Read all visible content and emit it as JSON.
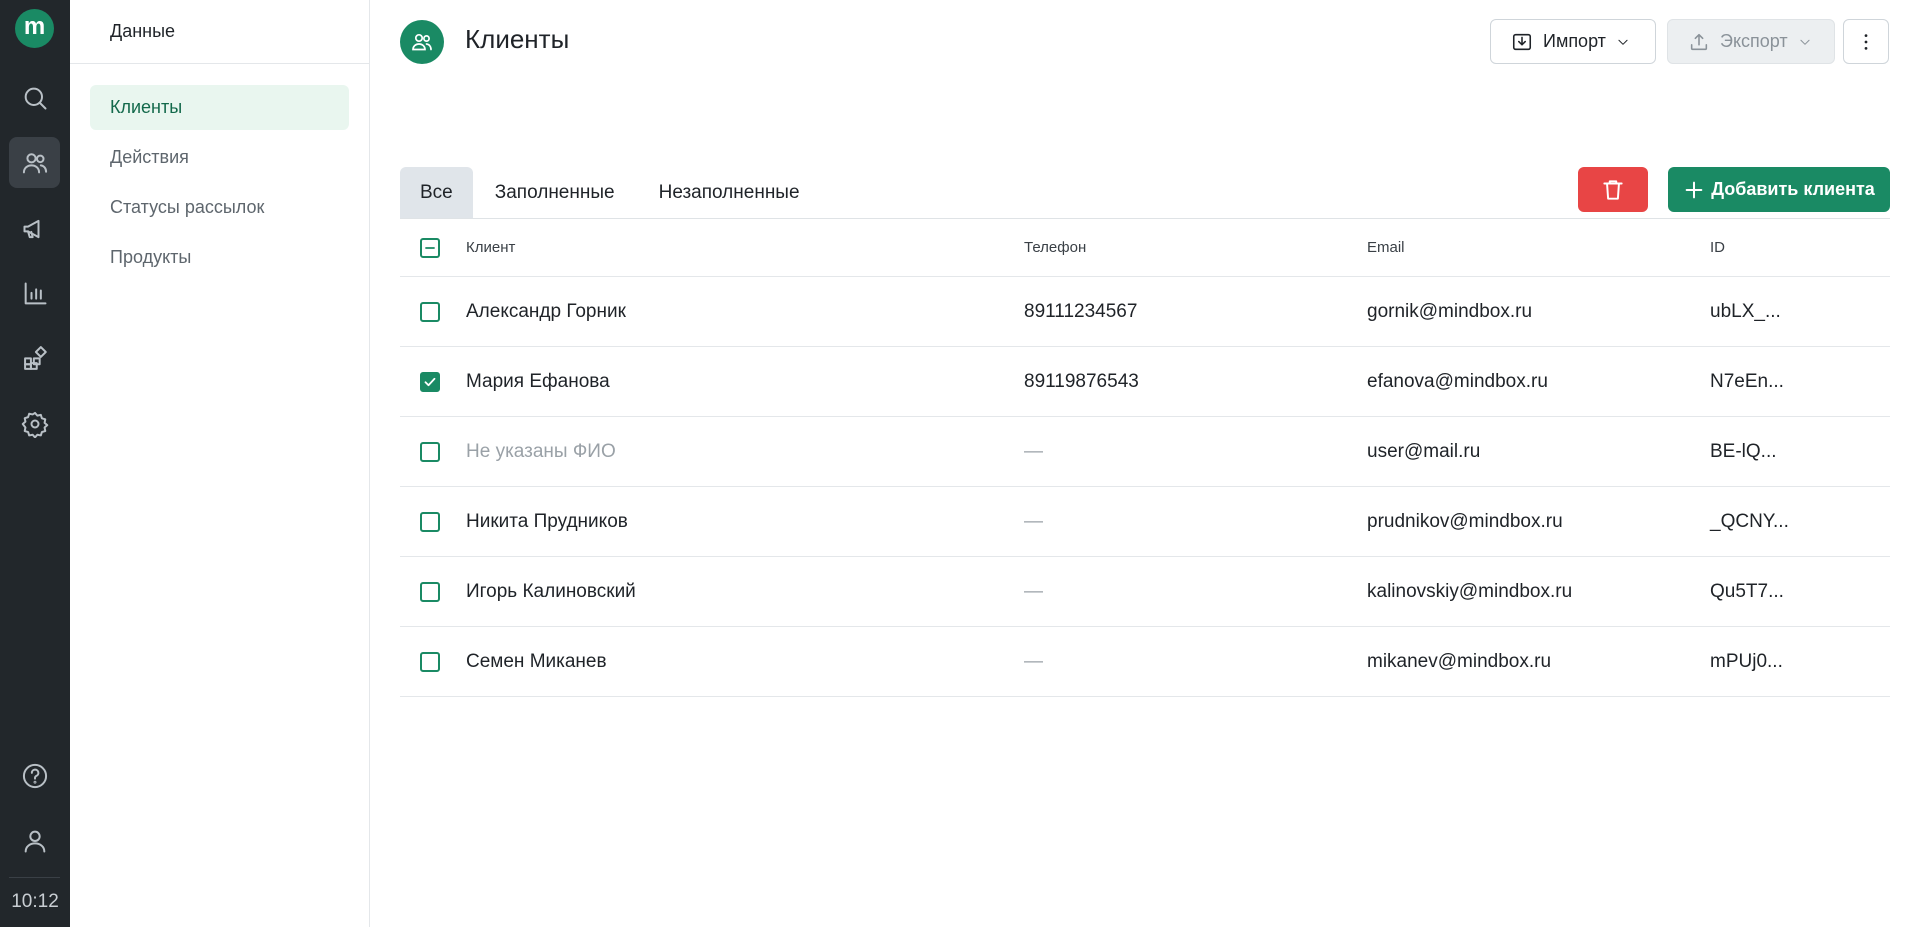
{
  "rail": {
    "logo_letter": "m",
    "icons": [
      "search-icon",
      "users-icon",
      "megaphone-icon",
      "chart-icon",
      "blocks-icon",
      "gear-icon",
      "help-icon",
      "user-icon"
    ],
    "time": "10:12"
  },
  "sidebar": {
    "title": "Данные",
    "items": [
      {
        "label": "Клиенты",
        "active": true
      },
      {
        "label": "Действия",
        "active": false
      },
      {
        "label": "Статусы рассылок",
        "active": false
      },
      {
        "label": "Продукты",
        "active": false
      }
    ]
  },
  "header": {
    "title": "Клиенты",
    "import_label": "Импорт",
    "export_label": "Экспорт"
  },
  "tabs": [
    {
      "label": "Все",
      "active": true
    },
    {
      "label": "Заполненные",
      "active": false
    },
    {
      "label": "Незаполненные",
      "active": false
    }
  ],
  "actions": {
    "add_label": "Добавить клиента"
  },
  "table": {
    "columns": {
      "client": "Клиент",
      "phone": "Телефон",
      "email": "Email",
      "id": "ID"
    },
    "rows": [
      {
        "name": "Александр Горник",
        "phone": "89111234567",
        "email": "gornik@mindbox.ru",
        "id": "ubLX_...",
        "checked": false,
        "name_muted": false
      },
      {
        "name": "Мария Ефанова",
        "phone": "89119876543",
        "email": "efanova@mindbox.ru",
        "id": "N7eEn...",
        "checked": true,
        "name_muted": false
      },
      {
        "name": "Не указаны ФИО",
        "phone": "—",
        "email": "user@mail.ru",
        "id": "BE-lQ...",
        "checked": false,
        "name_muted": true
      },
      {
        "name": "Никита Прудников",
        "phone": "—",
        "email": "prudnikov@mindbox.ru",
        "id": "_QCNY...",
        "checked": false,
        "name_muted": false
      },
      {
        "name": "Игорь Калиновский",
        "phone": "—",
        "email": "kalinovskiy@mindbox.ru",
        "id": "Qu5T7...",
        "checked": false,
        "name_muted": false
      },
      {
        "name": "Семен Миканев",
        "phone": "—",
        "email": "mikanev@mindbox.ru",
        "id": "mPUj0...",
        "checked": false,
        "name_muted": false
      }
    ]
  },
  "colors": {
    "brand": "#1a8a64",
    "danger": "#e84545",
    "rail_bg": "#22272b",
    "active_item_bg": "#e9f6ef"
  }
}
